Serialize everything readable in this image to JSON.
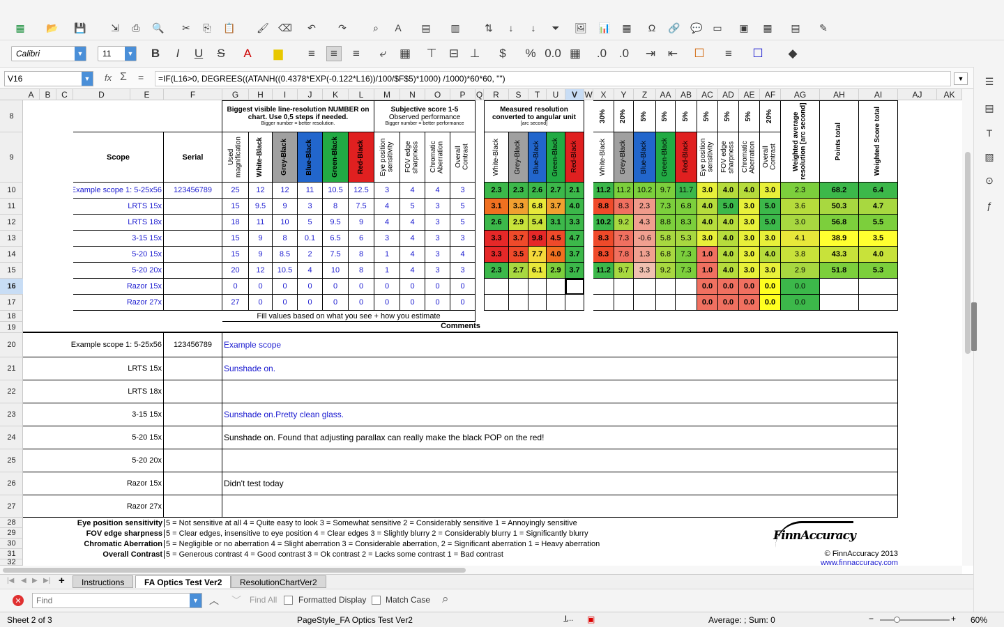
{
  "font": {
    "name": "Calibri",
    "size": "11"
  },
  "formula": {
    "cell_ref": "V16",
    "fx": "fx",
    "sum": "Σ",
    "eq": "=",
    "text": "=IF(L16>0, DEGREES((ATANH((0.4378*EXP(-0.122*L16))/100/$F$5)*1000) /1000)*60*60, \"\")"
  },
  "columns": [
    "A",
    "B",
    "C",
    "D",
    "E",
    "F",
    "G",
    "H",
    "I",
    "J",
    "K",
    "L",
    "M",
    "N",
    "O",
    "P",
    "Q",
    "R",
    "S",
    "T",
    "U",
    "V",
    "W",
    "X",
    "Y",
    "Z",
    "AA",
    "AB",
    "AC",
    "AD",
    "AE",
    "AF",
    "AG",
    "AH",
    "AI",
    "AJ",
    "AK"
  ],
  "rows": [
    "8",
    "9",
    "10",
    "11",
    "12",
    "13",
    "14",
    "15",
    "16",
    "17",
    "18",
    "19",
    "20",
    "21",
    "22",
    "23",
    "24",
    "25",
    "26",
    "27",
    "28",
    "29",
    "30",
    "31",
    "32"
  ],
  "headers": {
    "res_group": "Biggest visible line-resolution NUMBER on chart.  Use 0,5 steps if needed.",
    "res_sub": "Bigger number = better resolution.",
    "subj_group": "Subjective score 1-5",
    "subj_group2": "Observed performance",
    "subj_sub": "Bigger number = better performance",
    "meas_group": "Measured resolution converted to angular unit",
    "meas_sub": "[arc second]",
    "scope": "Scope",
    "serial": "Serial",
    "used_mag": "Used magnification",
    "colors": [
      "White-Black",
      "Grey-Black",
      "Blue-Black",
      "Green-Black",
      "Red-Black"
    ],
    "subj": [
      "Eye position sensitivity",
      "FOV edge sharpness",
      "Chromatic Aberration",
      "Overall Contrast"
    ],
    "weights": [
      "30%",
      "20%",
      "5%",
      "5%",
      "5%",
      "5%",
      "5%",
      "5%",
      "20%"
    ],
    "weighted_avg": "Weighted average resolution [arc second]",
    "points_total": "Points total",
    "weighted_score": "Weighted Score total",
    "fill_note": "Fill values based on what you see + how you estimate",
    "comments": "Comments"
  },
  "data_rows": [
    {
      "scope": "Example scope 1: 5-25x56",
      "serial": "123456789",
      "g": "25",
      "res": [
        "12",
        "12",
        "11",
        "10.5",
        "12.5"
      ],
      "subj": [
        "3",
        "4",
        "4",
        "3"
      ],
      "meas": [
        "2.3",
        "2.3",
        "2.6",
        "2.7",
        "2.1"
      ],
      "w": [
        "11.2",
        "11.2",
        "10.2",
        "9.7",
        "11.7",
        "3.0",
        "4.0",
        "4.0",
        "3.0"
      ],
      "ag": "2.3",
      "ah": "68.2",
      "ai": "6.4"
    },
    {
      "scope": "LRTS 15x",
      "serial": "",
      "g": "15",
      "res": [
        "9.5",
        "9",
        "3",
        "8",
        "7.5"
      ],
      "subj": [
        "4",
        "5",
        "3",
        "5"
      ],
      "meas": [
        "3.1",
        "3.3",
        "6.8",
        "3.7",
        "4.0"
      ],
      "w": [
        "8.8",
        "8.3",
        "2.3",
        "7.3",
        "6.8",
        "4.0",
        "5.0",
        "3.0",
        "5.0"
      ],
      "ag": "3.6",
      "ah": "50.3",
      "ai": "4.7"
    },
    {
      "scope": "LRTS 18x",
      "serial": "",
      "g": "18",
      "res": [
        "11",
        "10",
        "5",
        "9.5",
        "9"
      ],
      "subj": [
        "4",
        "4",
        "3",
        "5"
      ],
      "meas": [
        "2.6",
        "2.9",
        "5.4",
        "3.1",
        "3.3"
      ],
      "w": [
        "10.2",
        "9.2",
        "4.3",
        "8.8",
        "8.3",
        "4.0",
        "4.0",
        "3.0",
        "5.0"
      ],
      "ag": "3.0",
      "ah": "56.8",
      "ai": "5.5"
    },
    {
      "scope": "3-15 15x",
      "serial": "",
      "g": "15",
      "res": [
        "9",
        "8",
        "0.1",
        "6.5",
        "6"
      ],
      "subj": [
        "3",
        "4",
        "3",
        "3"
      ],
      "meas": [
        "3.3",
        "3.7",
        "9.8",
        "4.5",
        "4.7"
      ],
      "w": [
        "8.3",
        "7.3",
        "-0.6",
        "5.8",
        "5.3",
        "3.0",
        "4.0",
        "3.0",
        "3.0"
      ],
      "ag": "4.1",
      "ah": "38.9",
      "ai": "3.5"
    },
    {
      "scope": "5-20 15x",
      "serial": "",
      "g": "15",
      "res": [
        "9",
        "8.5",
        "2",
        "7.5",
        "8"
      ],
      "subj": [
        "1",
        "4",
        "3",
        "4"
      ],
      "meas": [
        "3.3",
        "3.5",
        "7.7",
        "4.0",
        "3.7"
      ],
      "w": [
        "8.3",
        "7.8",
        "1.3",
        "6.8",
        "7.3",
        "1.0",
        "4.0",
        "3.0",
        "4.0"
      ],
      "ag": "3.8",
      "ah": "43.3",
      "ai": "4.0"
    },
    {
      "scope": "5-20 20x",
      "serial": "",
      "g": "20",
      "res": [
        "12",
        "10.5",
        "4",
        "10",
        "8"
      ],
      "subj": [
        "1",
        "4",
        "3",
        "3"
      ],
      "meas": [
        "2.3",
        "2.7",
        "6.1",
        "2.9",
        "3.7"
      ],
      "w": [
        "11.2",
        "9.7",
        "3.3",
        "9.2",
        "7.3",
        "1.0",
        "4.0",
        "3.0",
        "3.0"
      ],
      "ag": "2.9",
      "ah": "51.8",
      "ai": "5.3"
    },
    {
      "scope": "Razor 15x",
      "serial": "",
      "g": "0",
      "res": [
        "0",
        "0",
        "0",
        "0",
        "0"
      ],
      "subj": [
        "0",
        "0",
        "0",
        "0"
      ],
      "meas": [
        "",
        "",
        "",
        "",
        ""
      ],
      "w": [
        "",
        "",
        "",
        "",
        "",
        "0.0",
        "0.0",
        "0.0",
        "0.0"
      ],
      "ag": "0.0",
      "ah": "",
      "ai": ""
    },
    {
      "scope": "Razor 27x",
      "serial": "",
      "g": "27",
      "res": [
        "0",
        "0",
        "0",
        "0",
        "0"
      ],
      "subj": [
        "0",
        "0",
        "0",
        "0"
      ],
      "meas": [
        "",
        "",
        "",
        "",
        ""
      ],
      "w": [
        "",
        "",
        "",
        "",
        "",
        "0.0",
        "0.0",
        "0.0",
        "0.0"
      ],
      "ag": "0.0",
      "ah": "",
      "ai": ""
    }
  ],
  "comment_rows": [
    {
      "scope": "Example scope 1: 5-25x56",
      "serial": "123456789",
      "comment": "Example scope",
      "blue": true
    },
    {
      "scope": "LRTS 15x",
      "serial": "",
      "comment": "Sunshade on.",
      "blue": true
    },
    {
      "scope": "LRTS 18x",
      "serial": "",
      "comment": "",
      "blue": false
    },
    {
      "scope": "3-15 15x",
      "serial": "",
      "comment": "Sunshade on.Pretty clean glass.",
      "blue": true
    },
    {
      "scope": "5-20 15x",
      "serial": "",
      "comment": "Sunshade on. Found that adjusting parallax can really make the black POP on the red!",
      "blue": false
    },
    {
      "scope": "5-20 20x",
      "serial": "",
      "comment": "",
      "blue": false
    },
    {
      "scope": "Razor 15x",
      "serial": "",
      "comment": "Didn't test today",
      "blue": false
    },
    {
      "scope": "Razor 27x",
      "serial": "",
      "comment": "",
      "blue": false
    }
  ],
  "legend": [
    {
      "key": "Eye position sensitivity",
      "text": "5 = Not sensitive at all  4 = Quite easy to look  3 = Somewhat sensitive  2 = Considerably sensitive  1 = Annoyingly sensitive"
    },
    {
      "key": "FOV edge sharpness",
      "text": "5 = Clear edges, insensitive to eye position  4 = Clear edges  3 = Slightly blurry  2 = Considerably blurry  1 = Significantly blurry"
    },
    {
      "key": "Chromatic Aberration",
      "text": "5 = Negligible or no aberration  4 = Slight aberration  3 = Considerable aberration, 2 = Significant aberration  1 = Heavy aberration"
    },
    {
      "key": "Overall Contrast",
      "text": "5 = Generous contrast  4 = Good contrast  3 = Ok contrast  2 = Lacks some contrast  1 = Bad contrast"
    }
  ],
  "logo": "FinnAccuracy",
  "copyright": "© FinnAccuracy 2013",
  "website": "www.finnaccuracy.com",
  "tabs": [
    "Instructions",
    "FA Optics Test Ver2",
    "ResolutionChartVer2"
  ],
  "find": {
    "placeholder": "Find",
    "find_all": "Find All",
    "formatted": "Formatted Display",
    "match_case": "Match Case"
  },
  "status": {
    "sheet": "Sheet 2 of 3",
    "pagestyle": "PageStyle_FA Optics Test Ver2",
    "summary": "Average: ; Sum: 0",
    "zoom": "60%"
  }
}
